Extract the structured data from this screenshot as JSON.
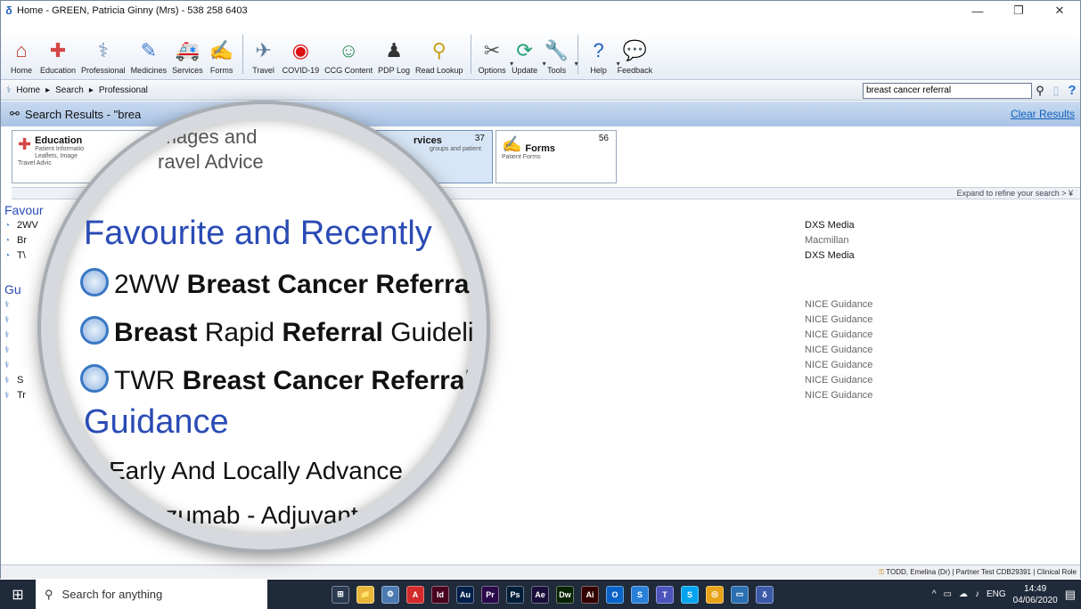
{
  "window": {
    "title": "Home  -  GREEN, Patricia Ginny (Mrs) - 538 258 6403",
    "minimize": "—",
    "restore": "❐",
    "close": "✕"
  },
  "ribbon": [
    {
      "label": "Home",
      "icon": "home-icon",
      "glyph": "⌂",
      "color": "#c0392b"
    },
    {
      "label": "Education",
      "icon": "education-icon",
      "glyph": "✚",
      "color": "#d64545"
    },
    {
      "label": "Professional",
      "icon": "caduceus-icon",
      "glyph": "⚕",
      "color": "#6a8fb5"
    },
    {
      "label": "Medicines",
      "icon": "medicines-icon",
      "glyph": "✎",
      "color": "#3b7bd0"
    },
    {
      "label": "Services",
      "icon": "ambulance-icon",
      "glyph": "🚑",
      "color": "#555"
    },
    {
      "label": "Forms",
      "icon": "forms-icon",
      "glyph": "✍",
      "color": "#4a6fa8"
    },
    {
      "label": "Travel",
      "icon": "plane-icon",
      "glyph": "✈",
      "color": "#5a7a9a"
    },
    {
      "label": "COVID-19",
      "icon": "siren-icon",
      "glyph": "◉",
      "color": "#d11"
    },
    {
      "label": "CCG Content",
      "icon": "people-icon",
      "glyph": "☺",
      "color": "#2e8b57"
    },
    {
      "label": "PDP Log",
      "icon": "graduate-icon",
      "glyph": "♟",
      "color": "#333"
    },
    {
      "label": "Read Lookup",
      "icon": "magnifier-icon",
      "glyph": "⚲",
      "color": "#c8a020"
    },
    {
      "label": "Options",
      "icon": "options-icon",
      "glyph": "✂",
      "color": "#555"
    },
    {
      "label": "Update",
      "icon": "update-icon",
      "glyph": "⟳",
      "color": "#1f9e6f"
    },
    {
      "label": "Tools",
      "icon": "wrench-icon",
      "glyph": "🔧",
      "color": "#3a78c4"
    },
    {
      "label": "Help",
      "icon": "help-icon",
      "glyph": "?",
      "color": "#1f5fbf"
    },
    {
      "label": "Feedback",
      "icon": "feedback-icon",
      "glyph": "💬",
      "color": "#7fb3e6"
    }
  ],
  "nav": {
    "home": "Home",
    "search": "Search",
    "professional": "Professional",
    "search_value": "breast cancer referral",
    "help_glyph": "?"
  },
  "search_results": {
    "title_prefix": "Search Results - \"brea",
    "clear": "Clear Results"
  },
  "cards": {
    "education_title": "Education",
    "education_desc1": "Patient Informatio",
    "education_desc2": "Leaflets, Image",
    "education_desc3": "Travel Advic",
    "services_title": "rvices",
    "services_count": "37",
    "services_desc": "groups and patient",
    "forms_title": "Forms",
    "forms_count": "56",
    "forms_desc": "Patient Forms"
  },
  "expand": "Expand to refine your search >",
  "results": {
    "section_fav": "Favour",
    "fav_rows": [
      "2WV",
      "Br",
      "T\\"
    ],
    "section_gui": "Gu",
    "gui_rows": [
      "",
      "",
      "",
      "",
      "",
      "S",
      "Tr"
    ],
    "sources_fav": [
      "DXS Media",
      "Macmillan",
      "DXS Media"
    ],
    "sources_gui": [
      "NICE Guidance",
      "NICE Guidance",
      "NICE Guidance",
      "NICE Guidance",
      "NICE Guidance",
      "NICE Guidance",
      "NICE Guidance"
    ]
  },
  "magnifier": {
    "head1": "lets, Images and",
    "head2": "ravel Advice",
    "section_fav": "Favourite and Recently",
    "row1_a": "2WW ",
    "row1_b": "Breast Cancer Referral",
    "row2_a": "Breast",
    "row2_b": " Rapid ",
    "row2_c": "Referral",
    "row2_d": " Guidelir",
    "row3_a": "TWR ",
    "row3_b": "Breast Cancer Referral",
    "section_gui": "Guidance",
    "gui1": "Early And Locally Advance",
    "gui2": "tuzumab - Adjuvant"
  },
  "status": {
    "text": "TODD, Emelina (Dr)  |  Partner Test CDB29391  |  Clinical Role"
  },
  "taskbar": {
    "search_placeholder": "Search for anything",
    "apps": [
      {
        "label": "⊞",
        "bg": "#2a3a50"
      },
      {
        "label": "📁",
        "bg": "#e8b73a"
      },
      {
        "label": "⚙",
        "bg": "#4a7ab0"
      },
      {
        "label": "A",
        "bg": "#d12b2b"
      },
      {
        "label": "Id",
        "bg": "#49021f"
      },
      {
        "label": "Au",
        "bg": "#00204a"
      },
      {
        "label": "Pr",
        "bg": "#2a0a4a"
      },
      {
        "label": "Ps",
        "bg": "#001e36"
      },
      {
        "label": "Ae",
        "bg": "#1a0f3a"
      },
      {
        "label": "Dw",
        "bg": "#072401"
      },
      {
        "label": "Ai",
        "bg": "#330000"
      },
      {
        "label": "O",
        "bg": "#0a64c8"
      },
      {
        "label": "S",
        "bg": "#2a7fd8"
      },
      {
        "label": "T",
        "bg": "#4b53bc"
      },
      {
        "label": "S",
        "bg": "#00a4ef"
      },
      {
        "label": "◎",
        "bg": "#e8a317"
      },
      {
        "label": "▭",
        "bg": "#2a6fb0"
      },
      {
        "label": "δ",
        "bg": "#3b5aa8"
      }
    ],
    "lang": "ENG",
    "time": "14:49",
    "date": "04/06/2020"
  }
}
